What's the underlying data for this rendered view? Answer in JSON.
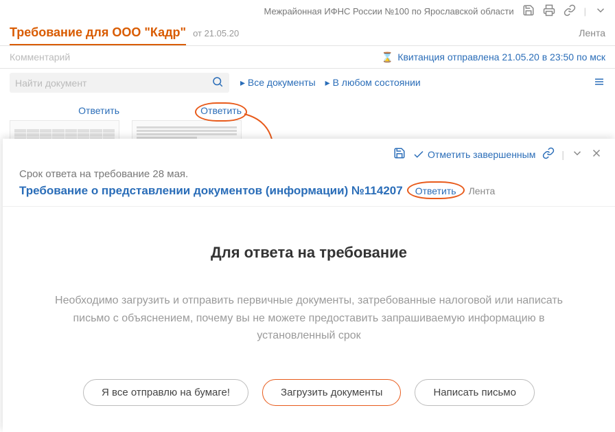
{
  "header": {
    "org": "Межрайонная ИФНС России №100 по Ярославской области"
  },
  "title": {
    "text": "Требование для ООО \"Кадр\"",
    "date": "от 21.05.20",
    "feed": "Лента"
  },
  "comment": {
    "placeholder": "Комментарий",
    "receipt": "Квитанция отправлена 21.05.20 в 23:50 по мск"
  },
  "filter": {
    "search_placeholder": "Найти документ",
    "all_docs": "Все документы",
    "any_state": "В любом состоянии"
  },
  "docs": {
    "reply": "Ответить"
  },
  "panel": {
    "mark_complete": "Отметить завершенным",
    "deadline": "Срок ответа на требование 28 мая.",
    "title": "Требование о представлении документов (информации) №114207",
    "reply": "Ответить",
    "feed": "Лента",
    "heading": "Для ответа на требование",
    "description": "Необходимо загрузить и отправить первичные документы, затребованные налоговой или написать письмо с объяснением, почему вы не можете предоставить запрашиваемую информацию в установленный срок",
    "btn_paper": "Я все отправлю на бумаге!",
    "btn_upload": "Загрузить документы",
    "btn_letter": "Написать письмо"
  }
}
